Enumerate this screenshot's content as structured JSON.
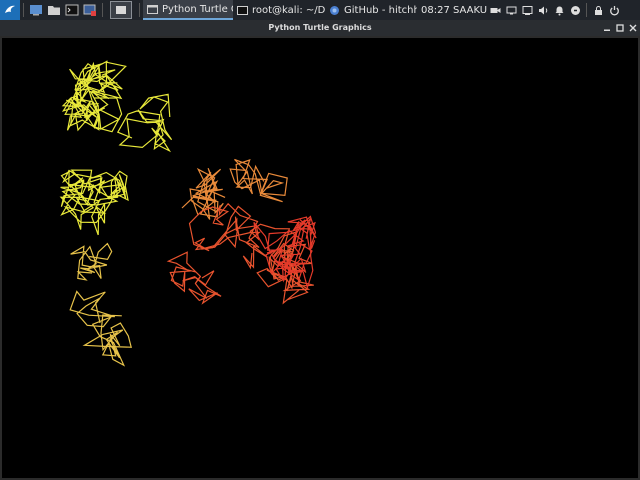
{
  "taskbar": {
    "launchers": [
      {
        "icon": "kali-menu-icon"
      },
      {
        "icon": "desktop-icon"
      },
      {
        "icon": "file-manager-icon"
      },
      {
        "icon": "terminal-icon"
      },
      {
        "icon": "terminal-root-icon"
      }
    ],
    "workspace_icon": "workspace-icon",
    "tasks": [
      {
        "label": "Python Turtle G...",
        "icon": "window-icon",
        "active": true
      },
      {
        "label": "root@kali: ~/De...",
        "icon": "terminal-icon",
        "active": false
      },
      {
        "label": "GitHub - hitchhi...",
        "icon": "browser-icon",
        "active": false
      }
    ],
    "clock": "08:27 SAAKU",
    "tray": [
      "camera-icon",
      "display-icon",
      "monitor-icon",
      "volume-icon",
      "bell-icon",
      "power-status-icon",
      "lock-icon",
      "power-icon"
    ]
  },
  "window": {
    "title": "Python Turtle Graphics",
    "controls": [
      "minimize-icon",
      "maximize-icon",
      "close-icon"
    ]
  },
  "canvas": {
    "background": "#000000",
    "colors": {
      "yellow": "#e8e83a",
      "yellow_orange": "#e6c24a",
      "orange": "#e98a3a",
      "red_orange": "#e8532e",
      "red": "#e53a2a"
    }
  }
}
